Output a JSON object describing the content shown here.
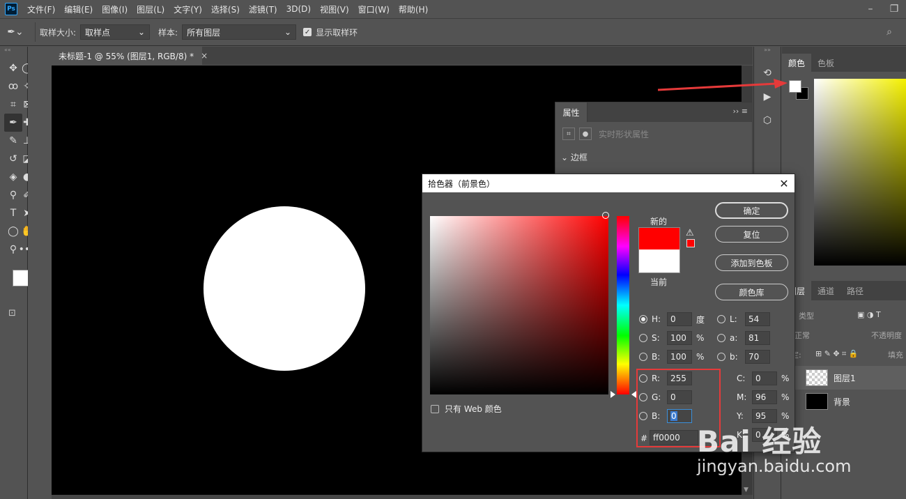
{
  "app": {
    "logo": "Ps"
  },
  "menu": [
    "文件(F)",
    "编辑(E)",
    "图像(I)",
    "图层(L)",
    "文字(Y)",
    "选择(S)",
    "滤镜(T)",
    "3D(D)",
    "视图(V)",
    "窗口(W)",
    "帮助(H)"
  ],
  "options": {
    "sample_size_label": "取样大小:",
    "sample_size_value": "取样点",
    "sample_label": "样本:",
    "sample_value": "所有图层",
    "show_ring_label": "显示取样环"
  },
  "document": {
    "tab_title": "未标题-1 @ 55% (图层1, RGB/8) *"
  },
  "properties": {
    "tab": "属性",
    "subtitle": "实时形状属性",
    "section": "边框"
  },
  "color_panel": {
    "tabs": [
      "颜色",
      "色板"
    ]
  },
  "layers_panel": {
    "tabs": [
      "图层",
      "通道",
      "路径"
    ],
    "filter_label": "类型",
    "blend_mode": "正常",
    "opacity_label": "不透明度",
    "lock_label": "锁定:",
    "fill_label": "填充",
    "layers": [
      {
        "name": "图层1"
      },
      {
        "name": "背景"
      }
    ]
  },
  "dialog": {
    "title": "拾色器（前景色）",
    "new_label": "新的",
    "current_label": "当前",
    "buttons": {
      "ok": "确定",
      "reset": "复位",
      "add_swatch": "添加到色板",
      "libraries": "颜色库"
    },
    "web_only_label": "只有 Web 颜色",
    "fields": {
      "H": {
        "label": "H:",
        "value": "0",
        "unit": "度"
      },
      "S": {
        "label": "S:",
        "value": "100",
        "unit": "%"
      },
      "Bv": {
        "label": "B:",
        "value": "100",
        "unit": "%"
      },
      "R": {
        "label": "R:",
        "value": "255"
      },
      "G": {
        "label": "G:",
        "value": "0"
      },
      "Bl": {
        "label": "B:",
        "value": "0"
      },
      "L": {
        "label": "L:",
        "value": "54"
      },
      "a": {
        "label": "a:",
        "value": "81"
      },
      "b": {
        "label": "b:",
        "value": "70"
      },
      "C": {
        "label": "C:",
        "value": "0",
        "unit": "%"
      },
      "M": {
        "label": "M:",
        "value": "96",
        "unit": "%"
      },
      "Y": {
        "label": "Y:",
        "value": "95",
        "unit": "%"
      },
      "K": {
        "label": "K:",
        "value": "0",
        "unit": "%"
      }
    },
    "hex_label": "#",
    "hex_value": "ff0000"
  },
  "colors": {
    "new_color": "#ff0000",
    "current_color": "#ffffff",
    "accent": "#e53a3a"
  },
  "watermark": {
    "logo": "Bai 经验",
    "url": "jingyan.baidu.com"
  }
}
